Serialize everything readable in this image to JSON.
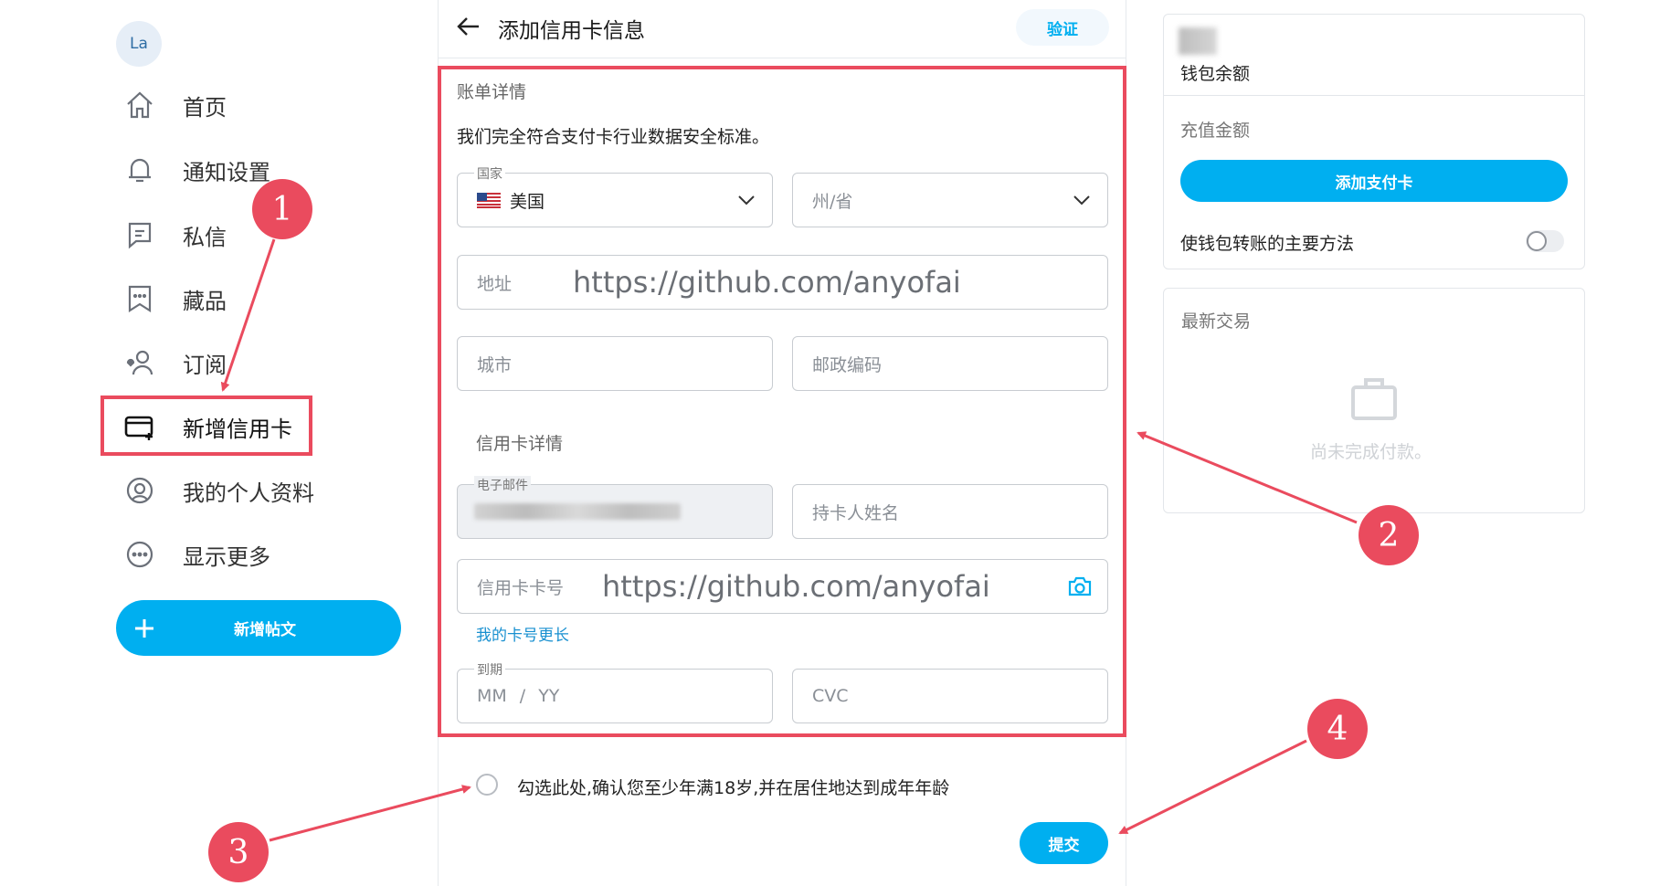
{
  "user": {
    "avatar_initials": "La"
  },
  "nav": {
    "items": [
      {
        "label": "首页",
        "icon": "home-icon"
      },
      {
        "label": "通知设置",
        "icon": "bell-icon"
      },
      {
        "label": "私信",
        "icon": "message-icon"
      },
      {
        "label": "藏品",
        "icon": "collections-icon"
      },
      {
        "label": "订阅",
        "icon": "subscriptions-icon"
      },
      {
        "label": "新增信用卡",
        "icon": "credit-card-add-icon",
        "active": true
      },
      {
        "label": "我的个人资料",
        "icon": "profile-icon"
      },
      {
        "label": "显示更多",
        "icon": "more-icon"
      }
    ],
    "new_post_label": "新增帖文"
  },
  "header": {
    "title": "添加信用卡信息",
    "verify_label": "验证"
  },
  "billing": {
    "section_title": "账单详情",
    "intro": "我们完全符合支付卡行业数据安全标准。",
    "country_label": "国家",
    "country_value": "美国",
    "state_placeholder": "州/省",
    "address_placeholder": "地址",
    "city_placeholder": "城市",
    "zip_placeholder": "邮政编码"
  },
  "card_details": {
    "section_title": "信用卡详情",
    "email_label": "电子邮件",
    "holder_placeholder": "持卡人姓名",
    "card_number_placeholder": "信用卡卡号",
    "longer_card_link": "我的卡号更长",
    "expiry_label": "到期",
    "expiry_mm": "MM",
    "expiry_sep": "/",
    "expiry_yy": "YY",
    "cvc_placeholder": "CVC"
  },
  "watermark": "https://github.com/anyofai",
  "agreement": {
    "text": "勾选此处,确认您至少年满18岁,并在居住地达到成年年龄",
    "checked": false
  },
  "submit_label": "提交",
  "wallet": {
    "balance_label": "钱包余额",
    "topup_label": "充值金额",
    "add_card_label": "添加支付卡",
    "primary_method_label": "使钱包转账的主要方法",
    "primary_method_enabled": false
  },
  "transactions": {
    "title": "最新交易",
    "empty_text": "尚未完成付款。"
  },
  "annotations": {
    "labels": [
      "1",
      "2",
      "3",
      "4"
    ],
    "color": "#ea4b5e"
  },
  "colors": {
    "accent": "#00aff0",
    "highlight": "#ea4b5e"
  }
}
